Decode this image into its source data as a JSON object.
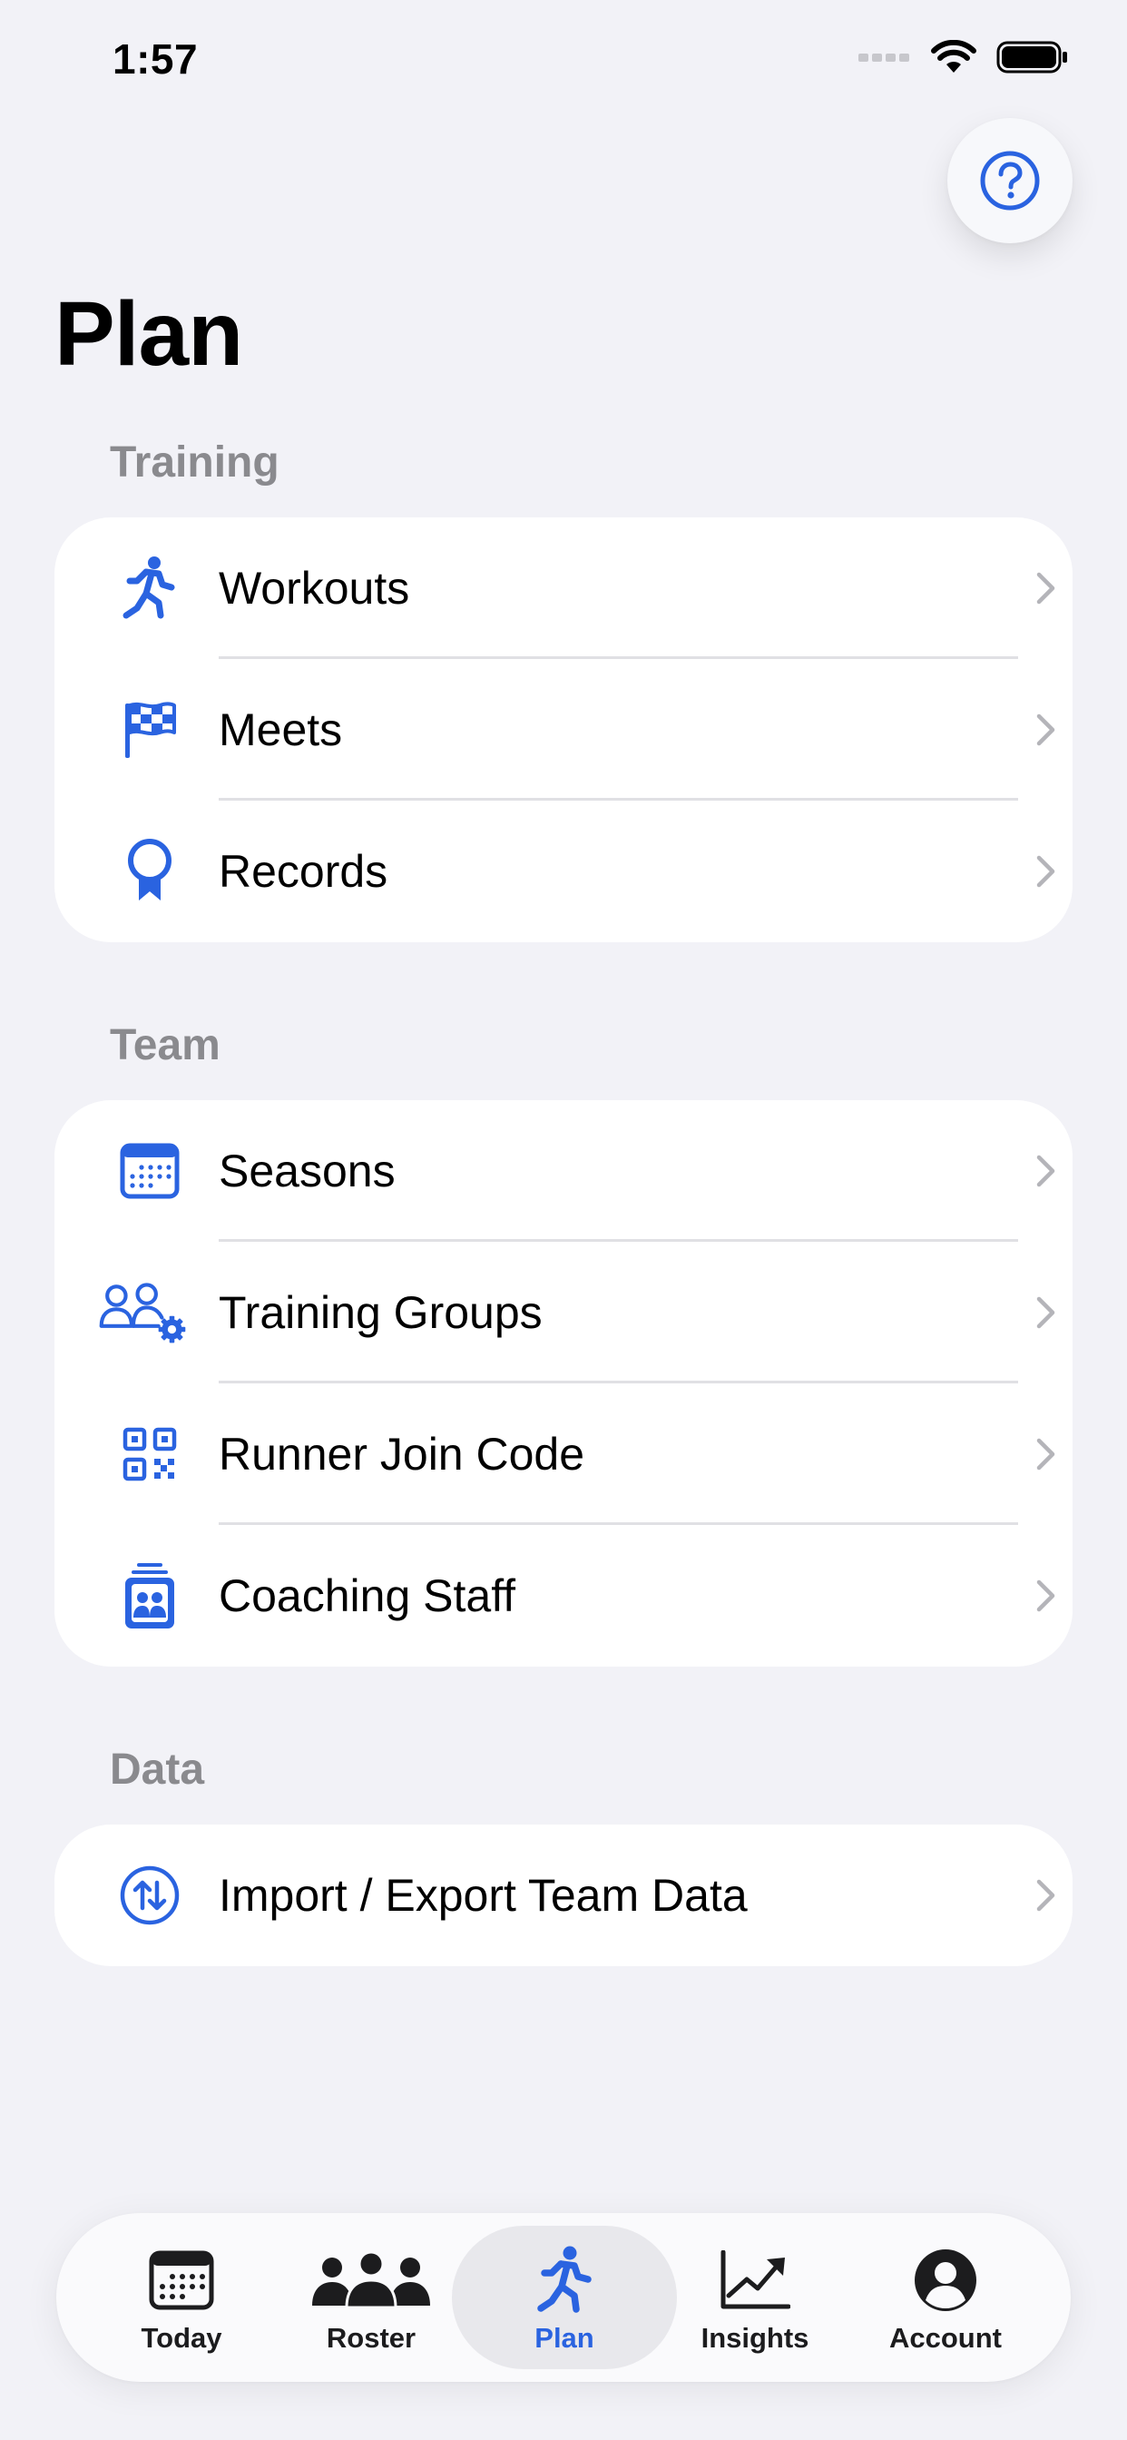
{
  "status_bar": {
    "time": "1:57"
  },
  "colors": {
    "accent": "#2A63E0",
    "background": "#F2F2F7",
    "section_header": "#8A8A8E",
    "chevron": "#B4B4B9"
  },
  "help_button": {
    "icon": "question-circle-icon"
  },
  "page": {
    "title": "Plan"
  },
  "sections": [
    {
      "header": "Training",
      "items": [
        {
          "label": "Workouts",
          "icon": "runner-icon"
        },
        {
          "label": "Meets",
          "icon": "checkered-flag-icon"
        },
        {
          "label": "Records",
          "icon": "medal-icon"
        }
      ]
    },
    {
      "header": "Team",
      "items": [
        {
          "label": "Seasons",
          "icon": "calendar-icon"
        },
        {
          "label": "Training Groups",
          "icon": "people-gear-icon"
        },
        {
          "label": "Runner Join Code",
          "icon": "qr-code-icon"
        },
        {
          "label": "Coaching Staff",
          "icon": "id-badge-icon"
        }
      ]
    },
    {
      "header": "Data",
      "items": [
        {
          "label": "Import / Export Team Data",
          "icon": "arrows-up-down-circle-icon"
        }
      ]
    }
  ],
  "tab_bar": {
    "selected": "Plan",
    "tabs": [
      {
        "label": "Today",
        "icon": "calendar-icon"
      },
      {
        "label": "Roster",
        "icon": "people-icon"
      },
      {
        "label": "Plan",
        "icon": "runner-icon"
      },
      {
        "label": "Insights",
        "icon": "chart-trend-icon"
      },
      {
        "label": "Account",
        "icon": "person-circle-icon"
      }
    ]
  }
}
